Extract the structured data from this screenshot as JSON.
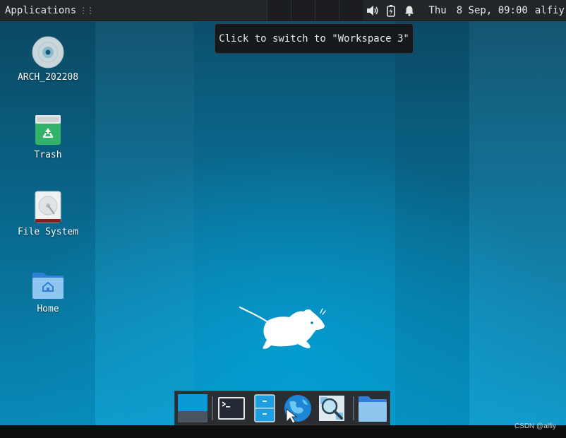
{
  "topbar": {
    "applications_label": "Applications",
    "clock_day": "Thu",
    "clock_date": "8 Sep, 09:00",
    "username": "alfiy",
    "tray_icons": [
      "volume-icon",
      "battery-icon",
      "bell-icon"
    ]
  },
  "tooltip": {
    "text": "Click to switch to \"Workspace 3\""
  },
  "desktop_icons": [
    {
      "label": "ARCH_202208",
      "icon": "optical-disc-icon"
    },
    {
      "label": "Trash",
      "icon": "trash-icon"
    },
    {
      "label": "File System",
      "icon": "hard-drive-icon"
    },
    {
      "label": "Home",
      "icon": "home-folder-icon"
    }
  ],
  "dock": {
    "items": [
      "show-desktop-icon",
      "terminal-icon",
      "file-manager-icon",
      "web-browser-icon",
      "app-finder-icon",
      "folder-icon"
    ]
  },
  "watermark": "CSDN @alfiy",
  "colors": {
    "panel": "#232629",
    "desktop_top": "#0b4f6c",
    "desktop_bottom": "#0996c9",
    "tooltip_bg": "#15191c"
  }
}
